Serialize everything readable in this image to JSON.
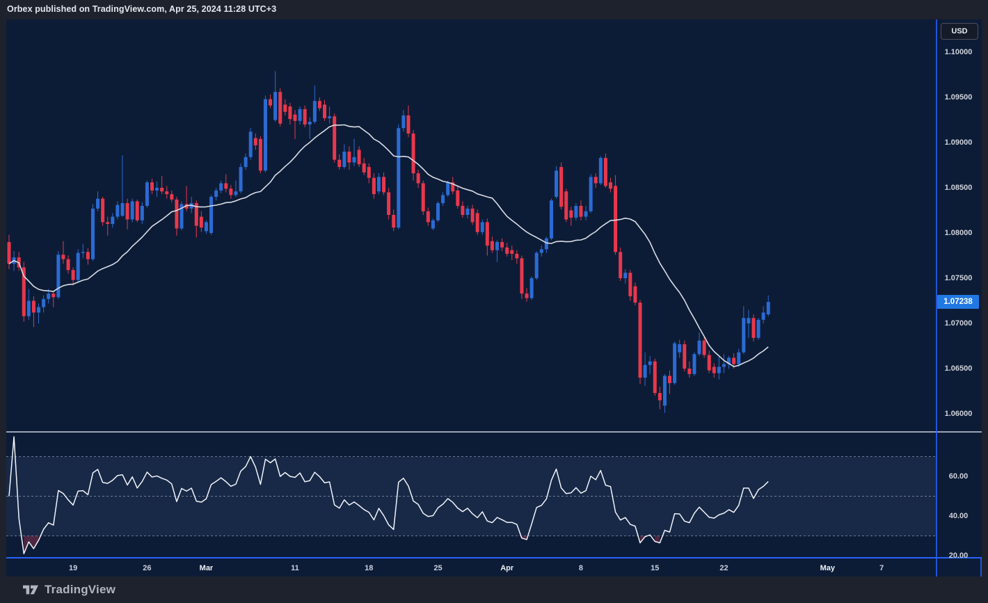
{
  "header": {
    "published_line": "Orbex published on TradingView.com, Apr 25, 2024 11:28 UTC+3"
  },
  "footer": {
    "brand": "TradingView",
    "logo_icon": "tradingview-logo"
  },
  "price_scale": {
    "currency_label": "USD",
    "ticks": [
      "1.10000",
      "1.09500",
      "1.09000",
      "1.08500",
      "1.08000",
      "1.07500",
      "1.07000",
      "1.06500",
      "1.06000"
    ],
    "last_price_label": "1.07238"
  },
  "rsi_scale": {
    "ticks": [
      "60.00",
      "40.00",
      "20.00"
    ]
  },
  "time_scale": {
    "labels": [
      {
        "text": "19",
        "bar": 13,
        "month": false
      },
      {
        "text": "26",
        "bar": 28,
        "month": false
      },
      {
        "text": "Mar",
        "bar": 40,
        "month": true
      },
      {
        "text": "11",
        "bar": 58,
        "month": false
      },
      {
        "text": "18",
        "bar": 73,
        "month": false
      },
      {
        "text": "25",
        "bar": 87,
        "month": false
      },
      {
        "text": "Apr",
        "bar": 101,
        "month": true
      },
      {
        "text": "8",
        "bar": 116,
        "month": false
      },
      {
        "text": "15",
        "bar": 131,
        "month": false
      },
      {
        "text": "22",
        "bar": 145,
        "month": false
      },
      {
        "text": "May",
        "bar": 166,
        "month": true
      },
      {
        "text": "7",
        "bar": 177,
        "month": false
      }
    ]
  },
  "colors": {
    "up": "#2b6bd4",
    "down": "#e8384c",
    "accent_blue": "#2962ff",
    "badge_blue": "#2178e4",
    "chart_bg": "#0d1c36",
    "frame_bg": "#1e222d",
    "ma_line": "#d9dde6",
    "rsi_line": "#f2f4fa",
    "separator": "#ccd2de",
    "band_fill": "rgba(125,160,230,0.10)",
    "level_dash": "rgba(195,205,228,0.5)",
    "rsi_oversold_fill": "rgba(246,70,93,0.28)"
  },
  "chart_data": [
    {
      "type": "candlestick",
      "currency": "USD",
      "last_price": 1.07238,
      "y_axis": {
        "tick_values": [
          1.1,
          1.095,
          1.09,
          1.085,
          1.08,
          1.075,
          1.07,
          1.065,
          1.06
        ],
        "visible_range": [
          1.058,
          1.1036
        ]
      },
      "x_axis": {
        "tick_labels": [
          "19",
          "26",
          "Mar",
          "11",
          "18",
          "25",
          "Apr",
          "8",
          "15",
          "22",
          "May",
          "7"
        ]
      },
      "overlays": [
        {
          "type": "sma",
          "period": 20
        }
      ],
      "candles": [
        [
          1.079,
          1.0798,
          1.076,
          1.0766
        ],
        [
          1.0766,
          1.078,
          1.0758,
          1.0773
        ],
        [
          1.0773,
          1.0779,
          1.0758,
          1.0762
        ],
        [
          1.0762,
          1.0768,
          1.0702,
          1.0708
        ],
        [
          1.0708,
          1.0738,
          1.0704,
          1.0725
        ],
        [
          1.0725,
          1.073,
          1.0696,
          1.0712
        ],
        [
          1.0712,
          1.0722,
          1.07,
          1.0718
        ],
        [
          1.0718,
          1.0731,
          1.0712,
          1.0727
        ],
        [
          1.0727,
          1.0738,
          1.0722,
          1.0733
        ],
        [
          1.0733,
          1.0736,
          1.0718,
          1.0729
        ],
        [
          1.0729,
          1.078,
          1.0727,
          1.0776
        ],
        [
          1.0776,
          1.0791,
          1.0766,
          1.0771
        ],
        [
          1.0771,
          1.0775,
          1.0755,
          1.0759
        ],
        [
          1.0759,
          1.0762,
          1.0742,
          1.0748
        ],
        [
          1.0748,
          1.0782,
          1.0746,
          1.0778
        ],
        [
          1.0778,
          1.0788,
          1.0772,
          1.0779
        ],
        [
          1.0779,
          1.0783,
          1.0765,
          1.0771
        ],
        [
          1.0771,
          1.0832,
          1.0769,
          1.0827
        ],
        [
          1.0827,
          1.0846,
          1.0824,
          1.0838
        ],
        [
          1.0838,
          1.084,
          1.0808,
          1.0812
        ],
        [
          1.0812,
          1.0818,
          1.0797,
          1.081
        ],
        [
          1.081,
          1.0822,
          1.0806,
          1.0818
        ],
        [
          1.0818,
          1.0835,
          1.0815,
          1.0831
        ],
        [
          1.0819,
          1.0886,
          1.0818,
          1.0833
        ],
        [
          1.0833,
          1.0838,
          1.0804,
          1.0815
        ],
        [
          1.0815,
          1.0838,
          1.0812,
          1.0835
        ],
        [
          1.0835,
          1.0837,
          1.0812,
          1.0814
        ],
        [
          1.0814,
          1.0834,
          1.081,
          1.083
        ],
        [
          1.083,
          1.0858,
          1.0828,
          1.0856
        ],
        [
          1.0856,
          1.086,
          1.0843,
          1.0847
        ],
        [
          1.0847,
          1.0857,
          1.084,
          1.085
        ],
        [
          1.085,
          1.0863,
          1.0843,
          1.0846
        ],
        [
          1.0846,
          1.0852,
          1.0838,
          1.0843
        ],
        [
          1.0843,
          1.0847,
          1.0834,
          1.0837
        ],
        [
          1.0837,
          1.084,
          1.0797,
          1.0805
        ],
        [
          1.0805,
          1.0835,
          1.0803,
          1.0832
        ],
        [
          1.0832,
          1.0852,
          1.0824,
          1.0827
        ],
        [
          1.0827,
          1.084,
          1.0822,
          1.0833
        ],
        [
          1.0833,
          1.0836,
          1.0795,
          1.0808
        ],
        [
          1.0818,
          1.0824,
          1.0801,
          1.0806
        ],
        [
          1.0802,
          1.0814,
          1.0799,
          1.0812
        ],
        [
          1.08,
          1.0842,
          1.0798,
          1.084
        ],
        [
          1.084,
          1.085,
          1.0836,
          1.0847
        ],
        [
          1.0847,
          1.0858,
          1.0844,
          1.0855
        ],
        [
          1.0855,
          1.0865,
          1.0845,
          1.0849
        ],
        [
          1.0849,
          1.0853,
          1.0838,
          1.0842
        ],
        [
          1.0842,
          1.0858,
          1.084,
          1.0846
        ],
        [
          1.0846,
          1.0877,
          1.0844,
          1.0873
        ],
        [
          1.0873,
          1.0888,
          1.087,
          1.0884
        ],
        [
          1.0884,
          1.0916,
          1.0881,
          1.0912
        ],
        [
          1.0905,
          1.091,
          1.0892,
          1.0897
        ],
        [
          1.0904,
          1.0907,
          1.0866,
          1.0869
        ],
        [
          1.0869,
          1.0952,
          1.0867,
          1.0948
        ],
        [
          1.0948,
          1.0953,
          1.0938,
          1.0941
        ],
        [
          1.0925,
          1.0979,
          1.0923,
          1.0956
        ],
        [
          1.0956,
          1.096,
          1.0918,
          1.0921
        ],
        [
          1.0942,
          1.0948,
          1.093,
          1.0934
        ],
        [
          1.094,
          1.0944,
          1.092,
          1.0926
        ],
        [
          1.0931,
          1.0936,
          1.0904,
          1.0924
        ],
        [
          1.0924,
          1.094,
          1.092,
          1.0937
        ],
        [
          1.0937,
          1.0941,
          1.0917,
          1.092
        ],
        [
          1.092,
          1.0928,
          1.0904,
          1.0923
        ],
        [
          1.0923,
          1.0963,
          1.0921,
          1.0946
        ],
        [
          1.0946,
          1.095,
          1.0935,
          1.0938
        ],
        [
          1.0942,
          1.0947,
          1.0924,
          1.0927
        ],
        [
          1.0927,
          1.094,
          1.0921,
          1.0929
        ],
        [
          1.0929,
          1.0932,
          1.0878,
          1.0881
        ],
        [
          1.0881,
          1.0887,
          1.087,
          1.0873
        ],
        [
          1.0873,
          1.0898,
          1.0871,
          1.089
        ],
        [
          1.089,
          1.0896,
          1.087,
          1.0878
        ],
        [
          1.0878,
          1.0904,
          1.0874,
          1.0884
        ],
        [
          1.0892,
          1.0896,
          1.0873,
          1.0876
        ],
        [
          1.0877,
          1.0883,
          1.0864,
          1.0867
        ],
        [
          1.0873,
          1.0877,
          1.0855,
          1.0861
        ],
        [
          1.0861,
          1.0866,
          1.0838,
          1.0843
        ],
        [
          1.0846,
          1.0866,
          1.0843,
          1.0862
        ],
        [
          1.0862,
          1.0867,
          1.0842,
          1.0845
        ],
        [
          1.0845,
          1.085,
          1.0815,
          1.082
        ],
        [
          1.082,
          1.0826,
          1.0802,
          1.0806
        ],
        [
          1.0806,
          1.092,
          1.0804,
          1.0916
        ],
        [
          1.0916,
          1.0936,
          1.0912,
          1.093
        ],
        [
          1.093,
          1.0941,
          1.0906,
          1.091
        ],
        [
          1.091,
          1.0914,
          1.0858,
          1.0866
        ],
        [
          1.0866,
          1.087,
          1.085,
          1.0855
        ],
        [
          1.0855,
          1.0858,
          1.082,
          1.0824
        ],
        [
          1.0824,
          1.0828,
          1.0808,
          1.0812
        ],
        [
          1.0805,
          1.0816,
          1.0803,
          1.0814
        ],
        [
          1.0814,
          1.0835,
          1.0812,
          1.0833
        ],
        [
          1.0833,
          1.0845,
          1.083,
          1.0842
        ],
        [
          1.0842,
          1.0858,
          1.084,
          1.0856
        ],
        [
          1.0856,
          1.0862,
          1.0843,
          1.0846
        ],
        [
          1.0847,
          1.0852,
          1.0827,
          1.083
        ],
        [
          1.083,
          1.0835,
          1.0817,
          1.082
        ],
        [
          1.082,
          1.083,
          1.0816,
          1.0827
        ],
        [
          1.0827,
          1.0831,
          1.0809,
          1.0812
        ],
        [
          1.0822,
          1.0826,
          1.0798,
          1.0801
        ],
        [
          1.0801,
          1.0815,
          1.0798,
          1.0812
        ],
        [
          1.0812,
          1.0816,
          1.0775,
          1.0786
        ],
        [
          1.0791,
          1.0796,
          1.0778,
          1.0781
        ],
        [
          1.0781,
          1.0792,
          1.0768,
          1.079
        ],
        [
          1.079,
          1.0794,
          1.078,
          1.0784
        ],
        [
          1.0784,
          1.0789,
          1.0774,
          1.0777
        ],
        [
          1.0781,
          1.0786,
          1.077,
          1.0777
        ],
        [
          1.0777,
          1.0781,
          1.0766,
          1.0772
        ],
        [
          1.0772,
          1.0775,
          1.0727,
          1.0733
        ],
        [
          1.0733,
          1.0739,
          1.0724,
          1.0728
        ],
        [
          1.0728,
          1.0752,
          1.0726,
          1.075
        ],
        [
          1.075,
          1.078,
          1.0748,
          1.0778
        ],
        [
          1.0778,
          1.0786,
          1.0774,
          1.0782
        ],
        [
          1.0782,
          1.0796,
          1.0778,
          1.0794
        ],
        [
          1.0794,
          1.0838,
          1.0792,
          1.0836
        ],
        [
          1.084,
          1.0874,
          1.0838,
          1.0869
        ],
        [
          1.0873,
          1.0878,
          1.0826,
          1.0829
        ],
        [
          1.0846,
          1.0849,
          1.0812,
          1.0815
        ],
        [
          1.0825,
          1.0829,
          1.0808,
          1.0817
        ],
        [
          1.0817,
          1.0833,
          1.0814,
          1.083
        ],
        [
          1.083,
          1.0836,
          1.0814,
          1.0818
        ],
        [
          1.0818,
          1.083,
          1.0814,
          1.0824
        ],
        [
          1.0824,
          1.0865,
          1.0822,
          1.0862
        ],
        [
          1.0862,
          1.0866,
          1.085,
          1.0855
        ],
        [
          1.0855,
          1.0885,
          1.0853,
          1.0883
        ],
        [
          1.0883,
          1.0888,
          1.085,
          1.0852
        ],
        [
          1.0856,
          1.0861,
          1.0845,
          1.0849
        ],
        [
          1.0852,
          1.0864,
          1.0776,
          1.0779
        ],
        [
          1.0779,
          1.0784,
          1.0747,
          1.075
        ],
        [
          1.075,
          1.076,
          1.0744,
          1.0756
        ],
        [
          1.0756,
          1.0759,
          1.0725,
          1.073
        ],
        [
          1.0741,
          1.0745,
          1.072,
          1.0723
        ],
        [
          1.0723,
          1.0726,
          1.0633,
          1.064
        ],
        [
          1.064,
          1.0668,
          1.0631,
          1.0654
        ],
        [
          1.0654,
          1.0664,
          1.0644,
          1.0658
        ],
        [
          1.0658,
          1.0661,
          1.062,
          1.0623
        ],
        [
          1.0623,
          1.063,
          1.0605,
          1.0615
        ],
        [
          1.0609,
          1.0644,
          1.0601,
          1.0642
        ],
        [
          1.0642,
          1.0648,
          1.0622,
          1.0634
        ],
        [
          1.0634,
          1.068,
          1.0632,
          1.0678
        ],
        [
          1.0668,
          1.0682,
          1.0662,
          1.0677
        ],
        [
          1.0677,
          1.0681,
          1.0647,
          1.065
        ],
        [
          1.065,
          1.0658,
          1.064,
          1.0644
        ],
        [
          1.0644,
          1.0668,
          1.0642,
          1.0666
        ],
        [
          1.0666,
          1.069,
          1.0664,
          1.0681
        ],
        [
          1.0681,
          1.0685,
          1.0662,
          1.0665
        ],
        [
          1.0665,
          1.067,
          1.0645,
          1.0648
        ],
        [
          1.0652,
          1.0656,
          1.064,
          1.0645
        ],
        [
          1.0645,
          1.0664,
          1.0638,
          1.0652
        ],
        [
          1.0652,
          1.0666,
          1.0645,
          1.0655
        ],
        [
          1.0655,
          1.0664,
          1.065,
          1.0662
        ],
        [
          1.0662,
          1.0667,
          1.065,
          1.0655
        ],
        [
          1.0655,
          1.0672,
          1.0652,
          1.0668
        ],
        [
          1.0668,
          1.0719,
          1.0666,
          1.0706
        ],
        [
          1.07,
          1.0715,
          1.0684,
          1.0706
        ],
        [
          1.0706,
          1.071,
          1.068,
          1.0684
        ],
        [
          1.0684,
          1.0706,
          1.0682,
          1.0704
        ],
        [
          1.0704,
          1.0719,
          1.07,
          1.0712
        ],
        [
          1.071,
          1.0731,
          1.0708,
          1.07238
        ]
      ]
    },
    {
      "type": "line",
      "name": "RSI",
      "period": 14,
      "source": "close",
      "levels": {
        "upper": 70,
        "middle": 50,
        "lower": 30
      },
      "band": [
        30,
        70
      ],
      "y_ticks": [
        60,
        40,
        20
      ],
      "visible_range": [
        19,
        82.5
      ]
    }
  ]
}
